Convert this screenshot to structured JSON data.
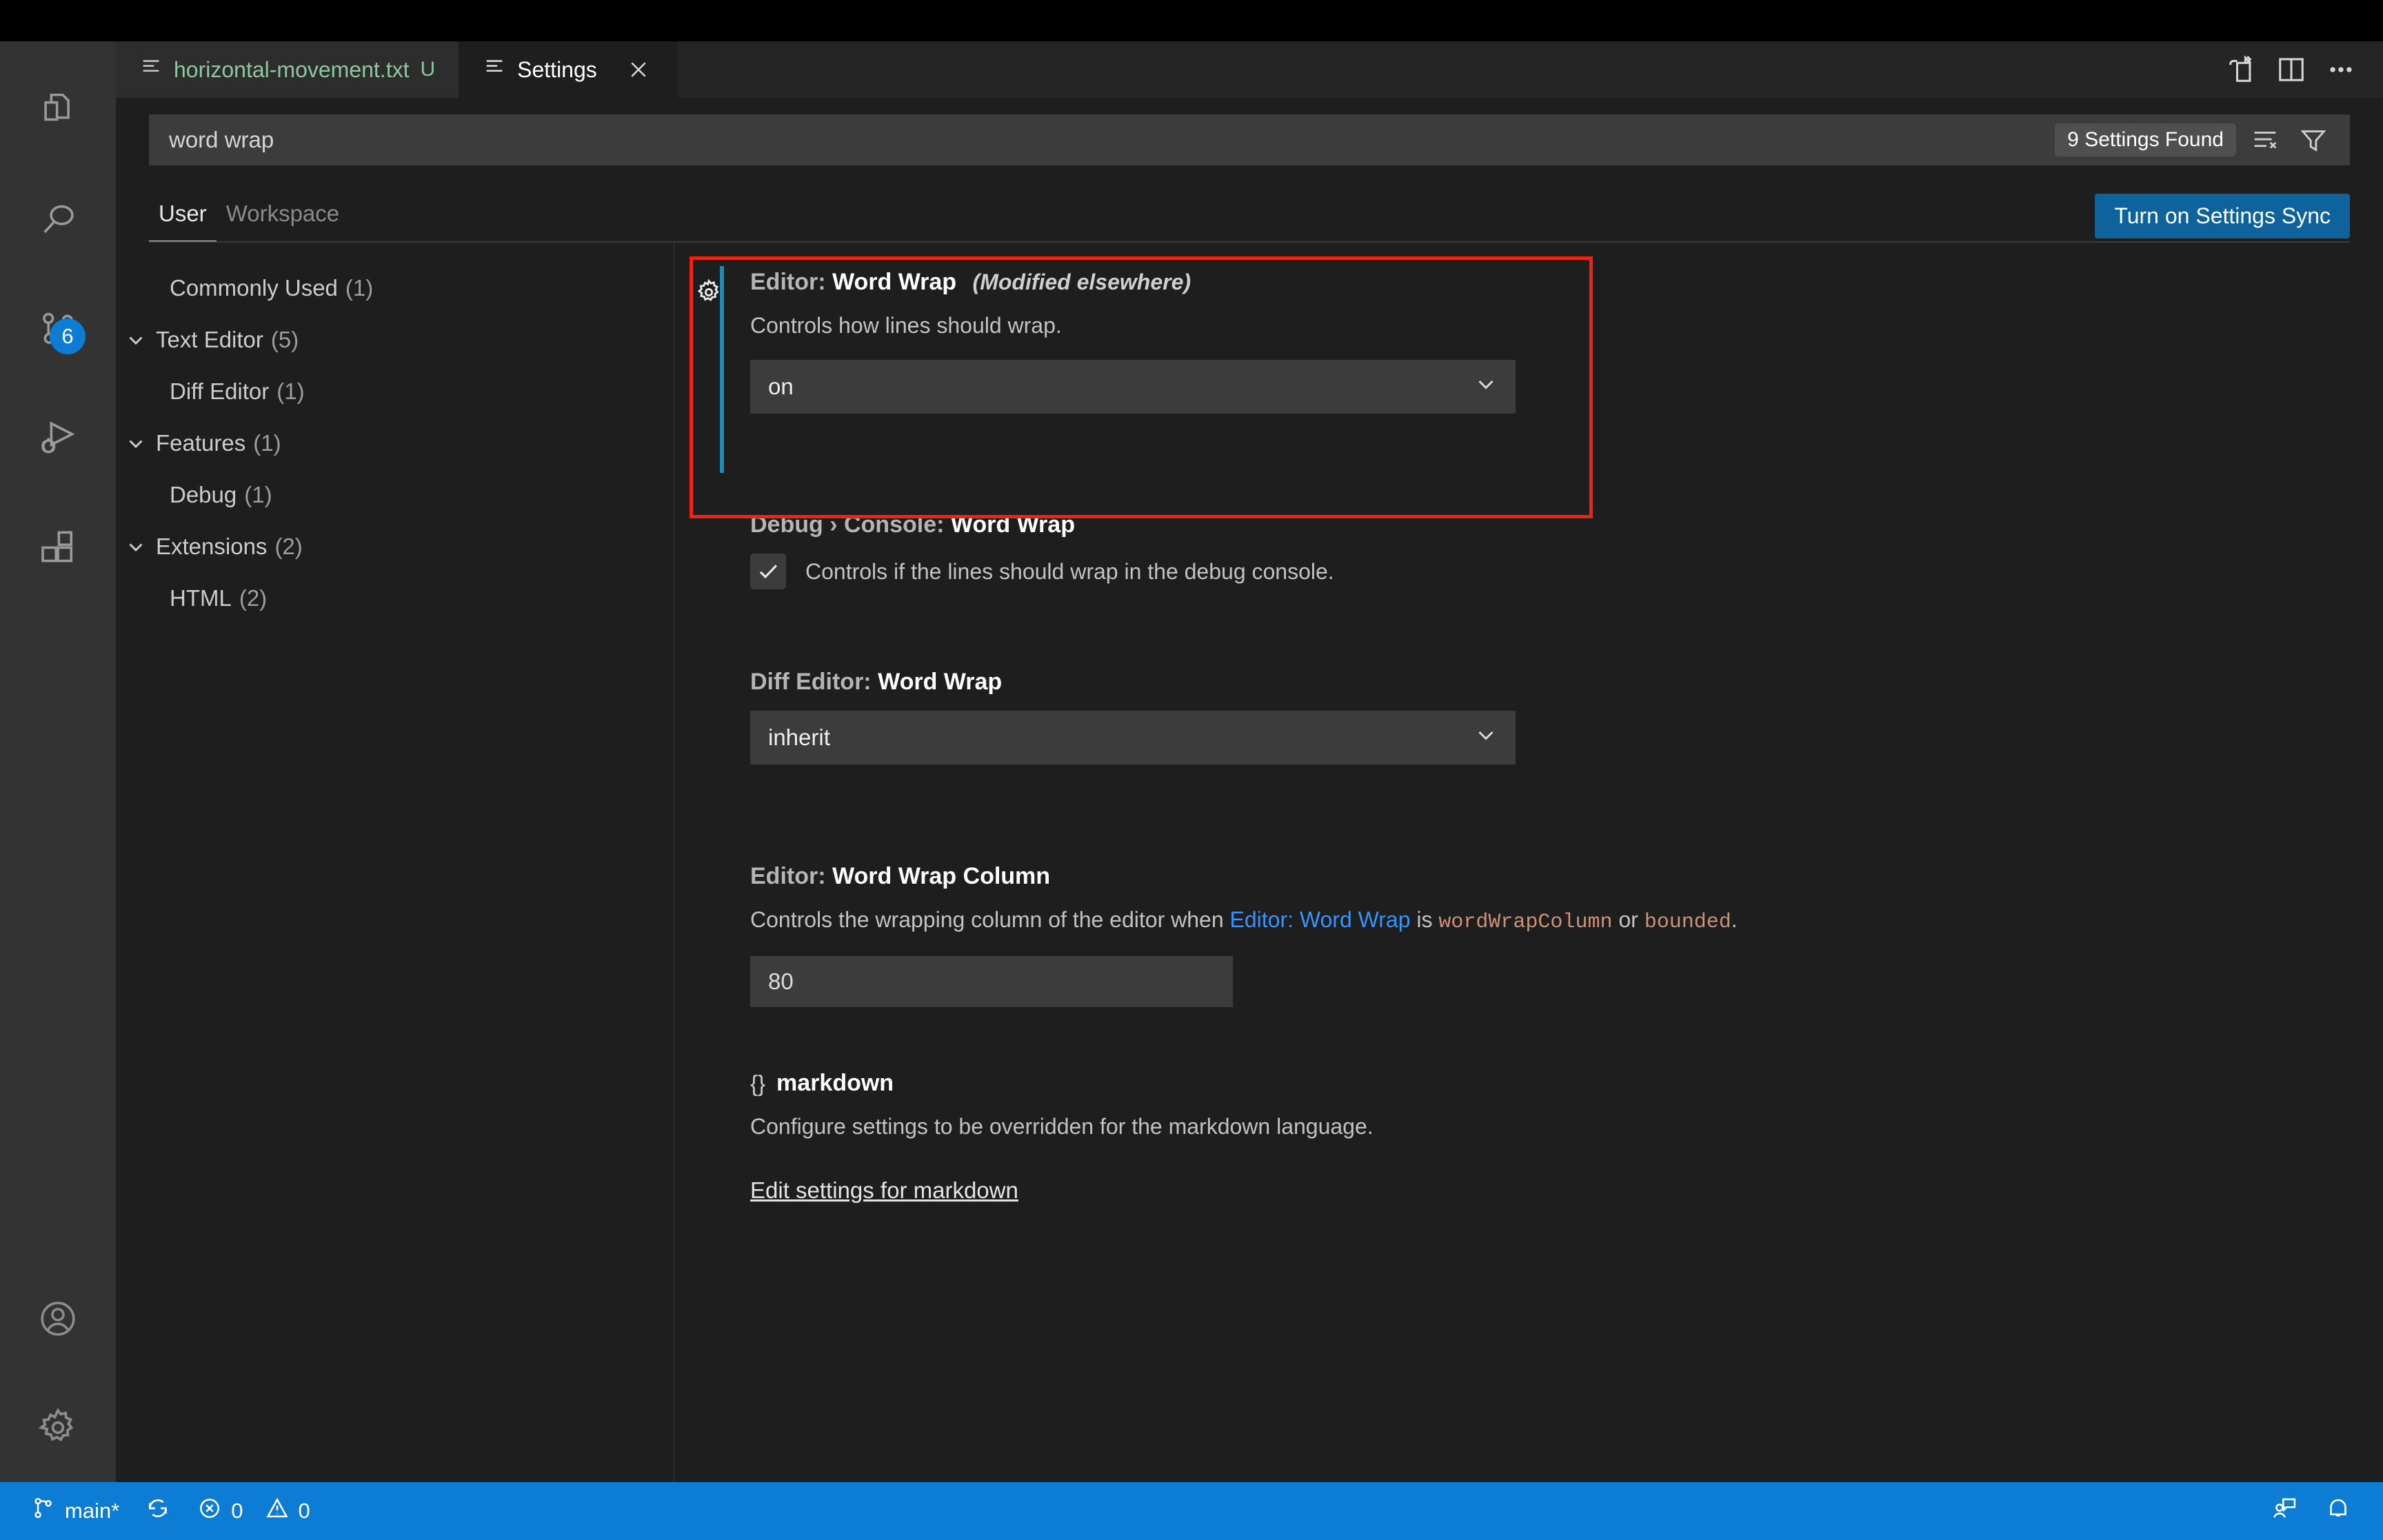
{
  "window": {
    "title": "Settings"
  },
  "activitybar": {
    "items": [
      {
        "name": "explorer",
        "icon": "files-icon",
        "badge": null
      },
      {
        "name": "search",
        "icon": "search-icon",
        "badge": null
      },
      {
        "name": "source-control",
        "icon": "source-control-icon",
        "badge": "6"
      },
      {
        "name": "run-and-debug",
        "icon": "run-debug-icon",
        "badge": null
      },
      {
        "name": "extensions",
        "icon": "extensions-icon",
        "badge": null
      }
    ],
    "bottom": [
      {
        "name": "accounts",
        "icon": "account-icon"
      },
      {
        "name": "manage",
        "icon": "gear-icon"
      }
    ]
  },
  "tabs": [
    {
      "label": "horizontal-movement.txt",
      "dirty_badge": "U",
      "icon": "text-file-icon",
      "active": false
    },
    {
      "label": "Settings",
      "dirty_badge": "",
      "icon": "settings-tab-icon",
      "active": true
    }
  ],
  "editor_actions": [
    {
      "name": "open-changes",
      "icon": "open-changes-icon"
    },
    {
      "name": "split-editor",
      "icon": "split-editor-icon"
    },
    {
      "name": "more-actions",
      "icon": "ellipsis-icon"
    }
  ],
  "search": {
    "value": "word wrap",
    "placeholder": "Search settings",
    "results_label": "9 Settings Found",
    "clear_icon": "clear-filter-icon",
    "filter_icon": "filter-icon"
  },
  "scope": {
    "tabs": [
      {
        "label": "User",
        "active": true
      },
      {
        "label": "Workspace",
        "active": false
      }
    ],
    "sync_button": "Turn on Settings Sync"
  },
  "toc": {
    "items": [
      {
        "label": "Commonly Used",
        "count": "(1)",
        "expandable": false,
        "indent": 1
      },
      {
        "label": "Text Editor",
        "count": "(5)",
        "expandable": true,
        "indent": 0
      },
      {
        "label": "Diff Editor",
        "count": "(1)",
        "expandable": false,
        "indent": 1
      },
      {
        "label": "Features",
        "count": "(1)",
        "expandable": true,
        "indent": 0
      },
      {
        "label": "Debug",
        "count": "(1)",
        "expandable": false,
        "indent": 1
      },
      {
        "label": "Extensions",
        "count": "(2)",
        "expandable": true,
        "indent": 0
      },
      {
        "label": "HTML",
        "count": "(2)",
        "expandable": false,
        "indent": 1
      }
    ]
  },
  "settings": [
    {
      "id": "editor-word-wrap",
      "category": "Editor:",
      "name": "Word Wrap",
      "modified_note": "(Modified elsewhere)",
      "description": "Controls how lines should wrap.",
      "control": "select",
      "value": "on",
      "modified": true,
      "highlighted": true,
      "gear": true
    },
    {
      "id": "debug-console-word-wrap",
      "category": "Debug › Console:",
      "name": "Word Wrap",
      "modified_note": "",
      "description": "Controls if the lines should wrap in the debug console.",
      "control": "checkbox",
      "value": "checked",
      "modified": false,
      "highlighted": false,
      "gear": false
    },
    {
      "id": "diff-editor-word-wrap",
      "category": "Diff Editor:",
      "name": "Word Wrap",
      "modified_note": "",
      "description": "",
      "control": "select",
      "value": "inherit",
      "modified": false,
      "highlighted": false,
      "gear": false
    },
    {
      "id": "editor-word-wrap-column",
      "category": "Editor:",
      "name": "Word Wrap Column",
      "modified_note": "",
      "description_parts": [
        {
          "type": "text",
          "text": "Controls the wrapping column of the editor when "
        },
        {
          "type": "link",
          "text": "Editor: Word Wrap"
        },
        {
          "type": "text",
          "text": " is "
        },
        {
          "type": "code",
          "text": "wordWrapColumn"
        },
        {
          "type": "text",
          "text": " or "
        },
        {
          "type": "code",
          "text": "bounded"
        },
        {
          "type": "text",
          "text": "."
        }
      ],
      "control": "text",
      "value": "80",
      "modified": false,
      "highlighted": false,
      "gear": false
    },
    {
      "id": "markdown-language-override",
      "language_title": "markdown",
      "braces": "{}",
      "description": "Configure settings to be overridden for the markdown language.",
      "control": "link",
      "value": "Edit settings for markdown",
      "modified": false,
      "highlighted": false,
      "gear": false
    }
  ],
  "annotation": {
    "color": "#f02313"
  },
  "statusbar": {
    "branch": "main*",
    "branch_icon": "source-control-branch-icon",
    "sync_icon": "sync-icon",
    "errors": "0",
    "warnings": "0",
    "error_icon": "error-icon",
    "warning_icon": "warning-icon",
    "right_items": [
      {
        "name": "feedback",
        "icon": "feedback-icon"
      },
      {
        "name": "notifications",
        "icon": "bell-icon"
      }
    ]
  }
}
